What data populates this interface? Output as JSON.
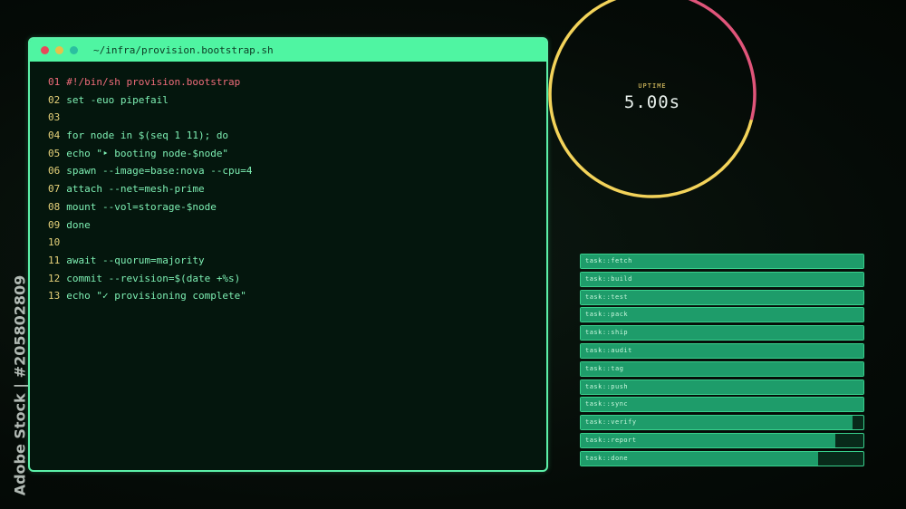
{
  "watermark": "Adobe Stock | #205802809",
  "terminal": {
    "title": "~/infra/provision.bootstrap.sh",
    "lines": [
      {
        "num": "01",
        "text": "#!/bin/sh provision.bootstrap"
      },
      {
        "num": "02",
        "text": "set -euo pipefail"
      },
      {
        "num": "03",
        "text": ""
      },
      {
        "num": "04",
        "text": "for node in $(seq 1 11); do"
      },
      {
        "num": "05",
        "text": "echo \"‣ booting node-$node\""
      },
      {
        "num": "06",
        "text": "spawn --image=base:nova --cpu=4"
      },
      {
        "num": "07",
        "text": "attach --net=mesh-prime"
      },
      {
        "num": "08",
        "text": "mount --vol=storage-$node"
      },
      {
        "num": "09",
        "text": "done"
      },
      {
        "num": "10",
        "text": ""
      },
      {
        "num": "11",
        "text": "await --quorum=majority"
      },
      {
        "num": "12",
        "text": "commit --revision=$(date +%s)"
      },
      {
        "num": "13",
        "text": "echo \"✓ provisioning complete\""
      }
    ]
  },
  "uptime": {
    "label": "UPTIME",
    "value": "5.00s",
    "ring_progress": 1.0,
    "accent_fraction": 0.29,
    "ring_color": "#f3d35a",
    "accent_color": "#e0557a"
  },
  "tasks": [
    {
      "label": "task::fetch",
      "progress": 1.0
    },
    {
      "label": "task::build",
      "progress": 1.0
    },
    {
      "label": "task::test",
      "progress": 1.0
    },
    {
      "label": "task::pack",
      "progress": 1.0
    },
    {
      "label": "task::ship",
      "progress": 1.0
    },
    {
      "label": "task::audit",
      "progress": 1.0
    },
    {
      "label": "task::tag",
      "progress": 1.0
    },
    {
      "label": "task::push",
      "progress": 1.0
    },
    {
      "label": "task::sync",
      "progress": 1.0
    },
    {
      "label": "task::verify",
      "progress": 0.96
    },
    {
      "label": "task::report",
      "progress": 0.9
    },
    {
      "label": "task::done",
      "progress": 0.84
    }
  ]
}
